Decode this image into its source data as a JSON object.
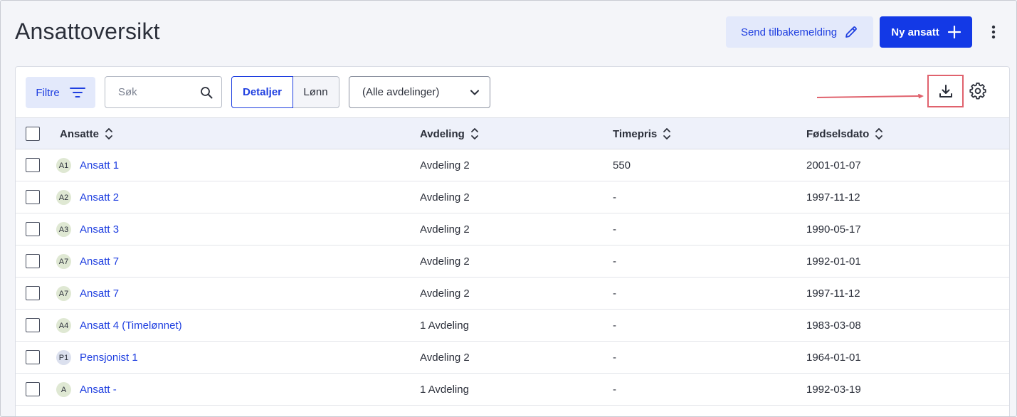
{
  "header": {
    "title": "Ansattoversikt",
    "feedback_label": "Send tilbakemelding",
    "new_employee_label": "Ny ansatt"
  },
  "toolbar": {
    "filter_label": "Filtre",
    "search_placeholder": "Søk",
    "view_details_label": "Detaljer",
    "view_salary_label": "Lønn",
    "department_selected": "(Alle avdelinger)"
  },
  "table": {
    "columns": [
      "Ansatte",
      "Avdeling",
      "Timepris",
      "Fødselsdato"
    ],
    "rows": [
      {
        "initials": "A1",
        "name": "Ansatt 1",
        "department": "Avdeling 2",
        "rate": "550",
        "birthdate": "2001-01-07"
      },
      {
        "initials": "A2",
        "name": "Ansatt 2",
        "department": "Avdeling 2",
        "rate": "-",
        "birthdate": "1997-11-12"
      },
      {
        "initials": "A3",
        "name": "Ansatt 3",
        "department": "Avdeling 2",
        "rate": "-",
        "birthdate": "1990-05-17"
      },
      {
        "initials": "A7",
        "name": "Ansatt 7",
        "department": "Avdeling 2",
        "rate": "-",
        "birthdate": "1992-01-01"
      },
      {
        "initials": "A7",
        "name": "Ansatt 7",
        "department": "Avdeling 2",
        "rate": "-",
        "birthdate": "1997-11-12"
      },
      {
        "initials": "A4",
        "name": "Ansatt 4 (Timelønnet)",
        "department": "1 Avdeling",
        "rate": "-",
        "birthdate": "1983-03-08"
      },
      {
        "initials": "P1",
        "name": "Pensjonist 1",
        "department": "Avdeling 2",
        "rate": "-",
        "birthdate": "1964-01-01"
      },
      {
        "initials": "A",
        "name": "Ansatt -",
        "department": "1 Avdeling",
        "rate": "-",
        "birthdate": "1992-03-19"
      }
    ]
  },
  "icons": {
    "feedback": "pencil-icon",
    "new": "plus-icon",
    "more": "kebab-menu-icon",
    "filter": "filter-lines-icon",
    "search": "search-icon",
    "dropdown": "chevron-down-icon",
    "download": "download-icon",
    "settings": "gear-icon",
    "sort": "sort-icon"
  },
  "colors": {
    "primary": "#1339e6",
    "link": "#1f3fe0",
    "primary_soft": "#e3e9fb",
    "annotation": "#e0626d"
  }
}
